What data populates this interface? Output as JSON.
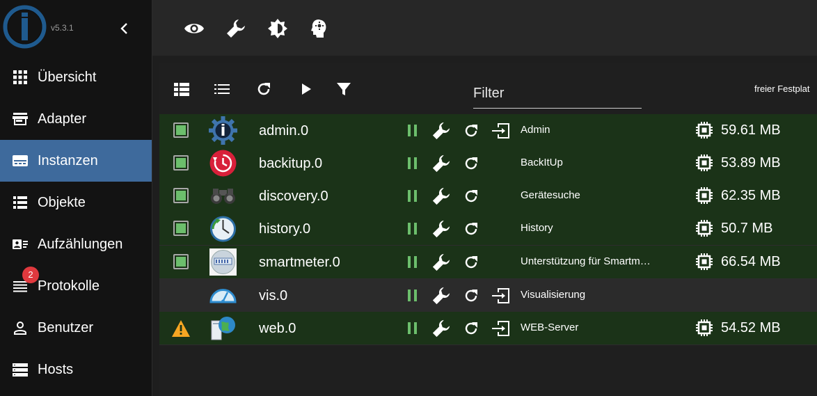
{
  "app": {
    "version": "v5.3.1"
  },
  "sidebar": {
    "items": [
      {
        "label": "Übersicht",
        "icon": "grid-icon"
      },
      {
        "label": "Adapter",
        "icon": "store-icon"
      },
      {
        "label": "Instanzen",
        "icon": "instances-icon",
        "active": true
      },
      {
        "label": "Objekte",
        "icon": "list-icon"
      },
      {
        "label": "Aufzählungen",
        "icon": "enum-icon"
      },
      {
        "label": "Protokolle",
        "icon": "log-icon",
        "badge": "2"
      },
      {
        "label": "Benutzer",
        "icon": "user-icon"
      },
      {
        "label": "Hosts",
        "icon": "hosts-icon"
      }
    ]
  },
  "topbar": {
    "icons": [
      "eye-icon",
      "wrench-icon",
      "theme-icon",
      "expert-mode-icon"
    ]
  },
  "toolbar": {
    "icons": [
      "table-view-icon",
      "list-view-icon",
      "refresh-icon",
      "play-icon",
      "filter-icon"
    ],
    "filter_placeholder": "Filter",
    "free_disk_label": "freier Festplat"
  },
  "instances": [
    {
      "name": "admin.0",
      "title": "Admin",
      "memory": "59.61 MB",
      "status": "checked",
      "open_url": true,
      "row": "green"
    },
    {
      "name": "backitup.0",
      "title": "BackItUp",
      "memory": "53.89 MB",
      "status": "checked",
      "open_url": false,
      "row": "green"
    },
    {
      "name": "discovery.0",
      "title": "Gerätesuche",
      "memory": "62.35 MB",
      "status": "checked",
      "open_url": false,
      "row": "green"
    },
    {
      "name": "history.0",
      "title": "History",
      "memory": "50.7 MB",
      "status": "checked",
      "open_url": false,
      "row": "green"
    },
    {
      "name": "smartmeter.0",
      "title": "Unterstützung für Smartm…",
      "memory": "66.54 MB",
      "status": "checked",
      "open_url": false,
      "row": "green"
    },
    {
      "name": "vis.0",
      "title": "Visualisierung",
      "memory": "",
      "status": "none",
      "open_url": true,
      "row": "grey"
    },
    {
      "name": "web.0",
      "title": "WEB-Server",
      "memory": "54.52 MB",
      "status": "warning",
      "open_url": true,
      "row": "green"
    }
  ],
  "colors": {
    "active_nav": "#3e6a9c",
    "row_green": "#1b3318",
    "pause_green": "#6cbe6c",
    "warning": "#f6a623"
  }
}
